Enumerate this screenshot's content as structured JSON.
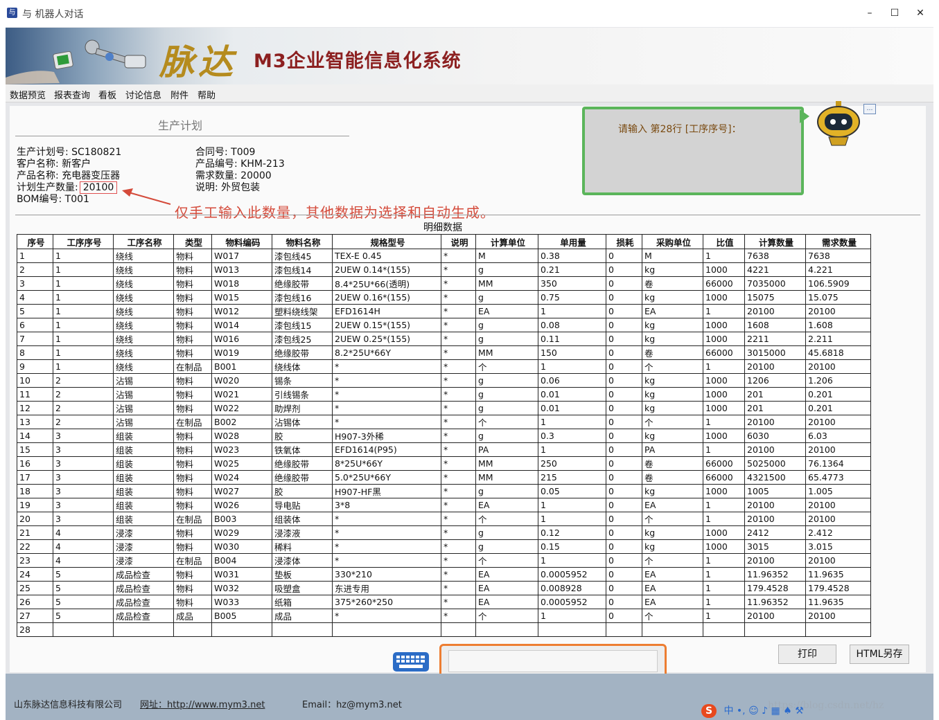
{
  "window": {
    "title": "与 机器人对话",
    "minimize": "–",
    "maximize": "☐",
    "close": "✕",
    "app_icon": "robot-app-icon"
  },
  "banner": {
    "logo_text": "脉达",
    "title": "M3企业智能信息化系统"
  },
  "menu": [
    "数据预览",
    "报表查询",
    "看板",
    "讨论信息",
    "附件",
    "帮助"
  ],
  "plan": {
    "title": "生产计划",
    "left": [
      {
        "label": "生产计划号:",
        "value": "SC180821"
      },
      {
        "label": "客户名称:",
        "value": "新客户"
      },
      {
        "label": "产品名称:",
        "value": "充电器变压器"
      },
      {
        "label": "计划生产数量:",
        "value": "20100"
      },
      {
        "label": "BOM编号:",
        "value": "T001"
      }
    ],
    "right": [
      {
        "label": "合同号:",
        "value": "T009"
      },
      {
        "label": "产品编号:",
        "value": "KHM-213"
      },
      {
        "label": "需求数量:",
        "value": "20000"
      },
      {
        "label": "说明:",
        "value": "外贸包装"
      }
    ]
  },
  "annotation": "仅手工输入此数量，其他数据为选择和自动生成。",
  "detail_caption": "明细数据",
  "chat": {
    "prompt": "请输入 第28行 [工序序号]：",
    "input_value": ""
  },
  "table": {
    "headers": [
      "序号",
      "工序序号",
      "工序名称",
      "类型",
      "物料编码",
      "物料名称",
      "规格型号",
      "说明",
      "计算单位",
      "单用量",
      "损耗",
      "采购单位",
      "比值",
      "计算数量",
      "需求数量"
    ],
    "rows": [
      [
        "1",
        "1",
        "绕线",
        "物料",
        "W017",
        "漆包线45",
        "TEX-E 0.45",
        "*",
        "M",
        "0.38",
        "0",
        "M",
        "1",
        "7638",
        "7638"
      ],
      [
        "2",
        "1",
        "绕线",
        "物料",
        "W013",
        "漆包线14",
        "2UEW 0.14*(155)",
        "*",
        "g",
        "0.21",
        "0",
        "kg",
        "1000",
        "4221",
        "4.221"
      ],
      [
        "3",
        "1",
        "绕线",
        "物料",
        "W018",
        "绝缘胶带",
        "8.4*25U*66(透明)",
        "*",
        "MM",
        "350",
        "0",
        "卷",
        "66000",
        "7035000",
        "106.5909"
      ],
      [
        "4",
        "1",
        "绕线",
        "物料",
        "W015",
        "漆包线16",
        "2UEW 0.16*(155)",
        "*",
        "g",
        "0.75",
        "0",
        "kg",
        "1000",
        "15075",
        "15.075"
      ],
      [
        "5",
        "1",
        "绕线",
        "物料",
        "W012",
        "塑料绕线架",
        "EFD1614H",
        "*",
        "EA",
        "1",
        "0",
        "EA",
        "1",
        "20100",
        "20100"
      ],
      [
        "6",
        "1",
        "绕线",
        "物料",
        "W014",
        "漆包线15",
        "2UEW 0.15*(155)",
        "*",
        "g",
        "0.08",
        "0",
        "kg",
        "1000",
        "1608",
        "1.608"
      ],
      [
        "7",
        "1",
        "绕线",
        "物料",
        "W016",
        "漆包线25",
        "2UEW 0.25*(155)",
        "*",
        "g",
        "0.11",
        "0",
        "kg",
        "1000",
        "2211",
        "2.211"
      ],
      [
        "8",
        "1",
        "绕线",
        "物料",
        "W019",
        "绝缘胶带",
        "8.2*25U*66Y",
        "*",
        "MM",
        "150",
        "0",
        "卷",
        "66000",
        "3015000",
        "45.6818"
      ],
      [
        "9",
        "1",
        "绕线",
        "在制品",
        "B001",
        "绕线体",
        "*",
        "*",
        "个",
        "1",
        "0",
        "个",
        "1",
        "20100",
        "20100"
      ],
      [
        "10",
        "2",
        "沾锡",
        "物料",
        "W020",
        "锡条",
        "*",
        "*",
        "g",
        "0.06",
        "0",
        "kg",
        "1000",
        "1206",
        "1.206"
      ],
      [
        "11",
        "2",
        "沾锡",
        "物料",
        "W021",
        "引线锡条",
        "*",
        "*",
        "g",
        "0.01",
        "0",
        "kg",
        "1000",
        "201",
        "0.201"
      ],
      [
        "12",
        "2",
        "沾锡",
        "物料",
        "W022",
        "助焊剂",
        "*",
        "*",
        "g",
        "0.01",
        "0",
        "kg",
        "1000",
        "201",
        "0.201"
      ],
      [
        "13",
        "2",
        "沾锡",
        "在制品",
        "B002",
        "沾锡体",
        "*",
        "*",
        "个",
        "1",
        "0",
        "个",
        "1",
        "20100",
        "20100"
      ],
      [
        "14",
        "3",
        "组装",
        "物料",
        "W028",
        "胶",
        "H907-3外稀",
        "*",
        "g",
        "0.3",
        "0",
        "kg",
        "1000",
        "6030",
        "6.03"
      ],
      [
        "15",
        "3",
        "组装",
        "物料",
        "W023",
        "铁氧体",
        "EFD1614(P95)",
        "*",
        "PA",
        "1",
        "0",
        "PA",
        "1",
        "20100",
        "20100"
      ],
      [
        "16",
        "3",
        "组装",
        "物料",
        "W025",
        "绝缘胶带",
        "8*25U*66Y",
        "*",
        "MM",
        "250",
        "0",
        "卷",
        "66000",
        "5025000",
        "76.1364"
      ],
      [
        "17",
        "3",
        "组装",
        "物料",
        "W024",
        "绝缘胶带",
        "5.0*25U*66Y",
        "*",
        "MM",
        "215",
        "0",
        "卷",
        "66000",
        "4321500",
        "65.4773"
      ],
      [
        "18",
        "3",
        "组装",
        "物料",
        "W027",
        "胶",
        "H907-HF黑",
        "*",
        "g",
        "0.05",
        "0",
        "kg",
        "1000",
        "1005",
        "1.005"
      ],
      [
        "19",
        "3",
        "组装",
        "物料",
        "W026",
        "导电贴",
        "3*8",
        "*",
        "EA",
        "1",
        "0",
        "EA",
        "1",
        "20100",
        "20100"
      ],
      [
        "20",
        "3",
        "组装",
        "在制品",
        "B003",
        "组装体",
        "*",
        "*",
        "个",
        "1",
        "0",
        "个",
        "1",
        "20100",
        "20100"
      ],
      [
        "21",
        "4",
        "浸漆",
        "物料",
        "W029",
        "浸漆液",
        "*",
        "*",
        "g",
        "0.12",
        "0",
        "kg",
        "1000",
        "2412",
        "2.412"
      ],
      [
        "22",
        "4",
        "浸漆",
        "物料",
        "W030",
        "稀料",
        "*",
        "*",
        "g",
        "0.15",
        "0",
        "kg",
        "1000",
        "3015",
        "3.015"
      ],
      [
        "23",
        "4",
        "浸漆",
        "在制品",
        "B004",
        "浸漆体",
        "*",
        "*",
        "个",
        "1",
        "0",
        "个",
        "1",
        "20100",
        "20100"
      ],
      [
        "24",
        "5",
        "成品检查",
        "物料",
        "W031",
        "垫板",
        "330*210",
        "*",
        "EA",
        "0.0005952",
        "0",
        "EA",
        "1",
        "11.96352",
        "11.9635"
      ],
      [
        "25",
        "5",
        "成品检查",
        "物料",
        "W032",
        "吸塑盒",
        "东进专用",
        "*",
        "EA",
        "0.008928",
        "0",
        "EA",
        "1",
        "179.4528",
        "179.4528"
      ],
      [
        "26",
        "5",
        "成品检查",
        "物料",
        "W033",
        "纸箱",
        "375*260*250",
        "*",
        "EA",
        "0.0005952",
        "0",
        "EA",
        "1",
        "11.96352",
        "11.9635"
      ],
      [
        "27",
        "5",
        "成品检查",
        "成品",
        "B005",
        "成品",
        "*",
        "*",
        "个",
        "1",
        "0",
        "个",
        "1",
        "20100",
        "20100"
      ],
      [
        "28",
        "",
        "",
        "",
        "",
        "",
        "",
        "",
        "",
        "",
        "",
        "",
        "",
        "",
        ""
      ]
    ]
  },
  "buttons": {
    "print": "打印",
    "save_html": "HTML另存"
  },
  "footer": {
    "company": "山东脉达信息科技有限公司",
    "website": "网址：http://www.mym3.net",
    "email": "Email：hz@mym3.net"
  },
  "tray": {
    "ime": "中",
    "watermark": "https://blog.csdn.net/hz"
  },
  "colors": {
    "chat_border": "#5bb55b",
    "input_border": "#ed7d31",
    "banner_title": "#8c2020",
    "annotation": "#d44a3a",
    "footer_bg": "#a3b3c3"
  }
}
